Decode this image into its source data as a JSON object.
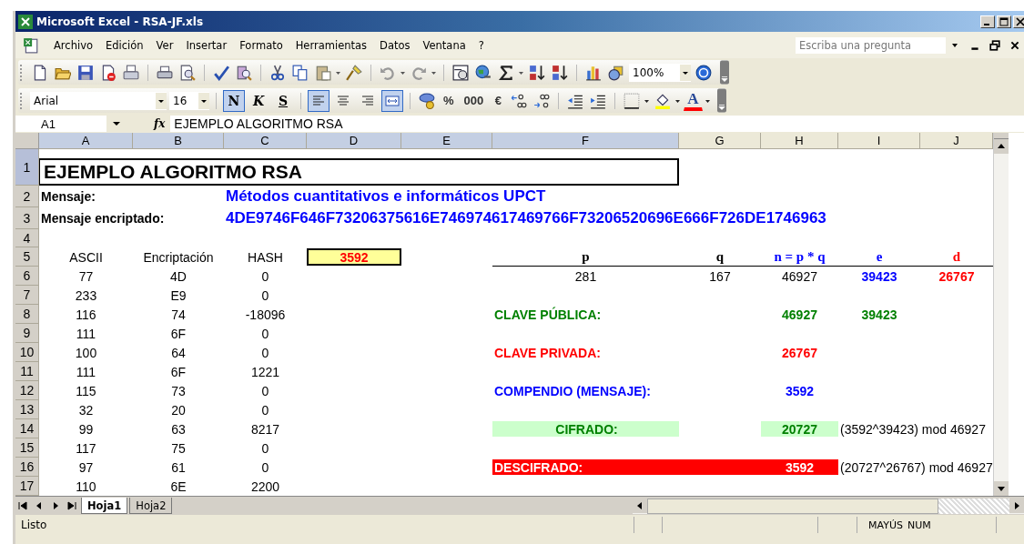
{
  "window": {
    "title": "Microsoft Excel - RSA-JF.xls"
  },
  "menu": {
    "items": [
      "Archivo",
      "Edición",
      "Ver",
      "Insertar",
      "Formato",
      "Herramientas",
      "Datos",
      "Ventana",
      "?"
    ],
    "question_box": {
      "placeholder": "Escriba una pregunta"
    }
  },
  "standard_toolbar": {
    "zoom": "100%"
  },
  "formatting_toolbar": {
    "font": "Arial",
    "size": "16",
    "styles": [
      {
        "label": "N",
        "kind": "bold",
        "selected": true
      },
      {
        "label": "K",
        "kind": "italic",
        "selected": false
      },
      {
        "label": "S",
        "kind": "underline",
        "selected": false
      }
    ],
    "alignment": [
      {
        "kind": "left",
        "selected": true
      },
      {
        "kind": "center",
        "selected": false
      },
      {
        "kind": "right",
        "selected": false
      },
      {
        "kind": "merge",
        "selected": true
      }
    ],
    "number_formats": [
      "%",
      "000",
      "€"
    ],
    "font_color": "A"
  },
  "formula_bar": {
    "name_box": "A1",
    "fx": "fx",
    "formula": "EJEMPLO ALGORITMO RSA"
  },
  "columns": [
    {
      "label": "A",
      "selected": true
    },
    {
      "label": "B",
      "selected": true
    },
    {
      "label": "C",
      "selected": true
    },
    {
      "label": "D",
      "selected": true
    },
    {
      "label": "E",
      "selected": true
    },
    {
      "label": "F",
      "selected": true
    },
    {
      "label": "G",
      "selected": false
    },
    {
      "label": "H",
      "selected": false
    },
    {
      "label": "I",
      "selected": false
    },
    {
      "label": "J",
      "selected": false
    }
  ],
  "rows": [
    {
      "label": "1",
      "selected": true
    },
    {
      "label": "2",
      "selected": false
    },
    {
      "label": "3",
      "selected": false
    },
    {
      "label": "4",
      "selected": false
    },
    {
      "label": "5",
      "selected": false
    },
    {
      "label": "6",
      "selected": false
    },
    {
      "label": "7",
      "selected": false
    },
    {
      "label": "8",
      "selected": false
    },
    {
      "label": "9",
      "selected": false
    },
    {
      "label": "10",
      "selected": false
    },
    {
      "label": "11",
      "selected": false
    },
    {
      "label": "12",
      "selected": false
    },
    {
      "label": "13",
      "selected": false
    },
    {
      "label": "14",
      "selected": false
    },
    {
      "label": "15",
      "selected": false
    },
    {
      "label": "16",
      "selected": false
    },
    {
      "label": "17",
      "selected": false
    }
  ],
  "sheet": {
    "title": "EJEMPLO ALGORITMO RSA",
    "message": {
      "label": "Mensaje:",
      "value": "Métodos cuantitativos e informáticos UPCT"
    },
    "encrypted": {
      "label": "Mensaje encriptado:",
      "value": "4DE9746F646F73206375616E746974617469766F73206520696E666F726DE1746963"
    },
    "hash_table": {
      "columns": [
        "ASCII",
        "Encriptación",
        "HASH"
      ],
      "rows": [
        [
          "77",
          "4D",
          "0"
        ],
        [
          "233",
          "E9",
          "0"
        ],
        [
          "116",
          "74",
          "-18096"
        ],
        [
          "111",
          "6F",
          "0"
        ],
        [
          "100",
          "64",
          "0"
        ],
        [
          "111",
          "6F",
          "1221"
        ],
        [
          "115",
          "73",
          "0"
        ],
        [
          "32",
          "20",
          "0"
        ],
        [
          "99",
          "63",
          "8217"
        ],
        [
          "117",
          "75",
          "0"
        ],
        [
          "97",
          "61",
          "0"
        ],
        [
          "110",
          "6E",
          "2200"
        ]
      ]
    },
    "hash_result": "3592",
    "params": [
      {
        "label": "p",
        "color": "#000000",
        "value": {
          "text": "281",
          "color": "#000000",
          "emphasis": false
        }
      },
      {
        "label": "q",
        "color": "#000000",
        "value": {
          "text": "167",
          "color": "#000000",
          "emphasis": false
        }
      },
      {
        "label": "n = p * q",
        "color": "#0000ff",
        "value": {
          "text": "46927",
          "color": "#000000",
          "emphasis": false
        }
      },
      {
        "label": "e",
        "color": "#0000ff",
        "value": {
          "text": "39423",
          "color": "#0000ff",
          "emphasis": true
        }
      },
      {
        "label": "d",
        "color": "#ff0000",
        "value": {
          "text": "26767",
          "color": "#ff0000",
          "emphasis": true
        }
      }
    ],
    "keys": [
      {
        "label": "CLAVE PÚBLICA:",
        "kind": "plain",
        "color": "#008000",
        "values": [
          "46927",
          "39423"
        ]
      },
      {
        "label": "CLAVE PRIVADA:",
        "kind": "plain",
        "color": "#ff0000",
        "values": [
          "26767"
        ]
      },
      {
        "label": "COMPENDIO (MENSAJE):",
        "kind": "plain",
        "color": "#0000ff",
        "values": [
          "3592"
        ]
      },
      {
        "label": "CIFRADO:",
        "kind": "filled",
        "color": "#008000",
        "values": [
          "20727"
        ],
        "note": "(3592^39423) mod 46927"
      },
      {
        "label": "DESCIFRADO:",
        "kind": "banner",
        "color": "#ff0000",
        "values": [
          "3592"
        ],
        "note": "(20727^26767) mod 46927"
      }
    ]
  },
  "sheet_tabs": [
    {
      "label": "Hoja1",
      "selected": true
    },
    {
      "label": "Hoja2",
      "selected": false
    }
  ],
  "status_bar": {
    "text": "Listo",
    "indicators": [
      "MAYÚS",
      "NUM"
    ]
  }
}
